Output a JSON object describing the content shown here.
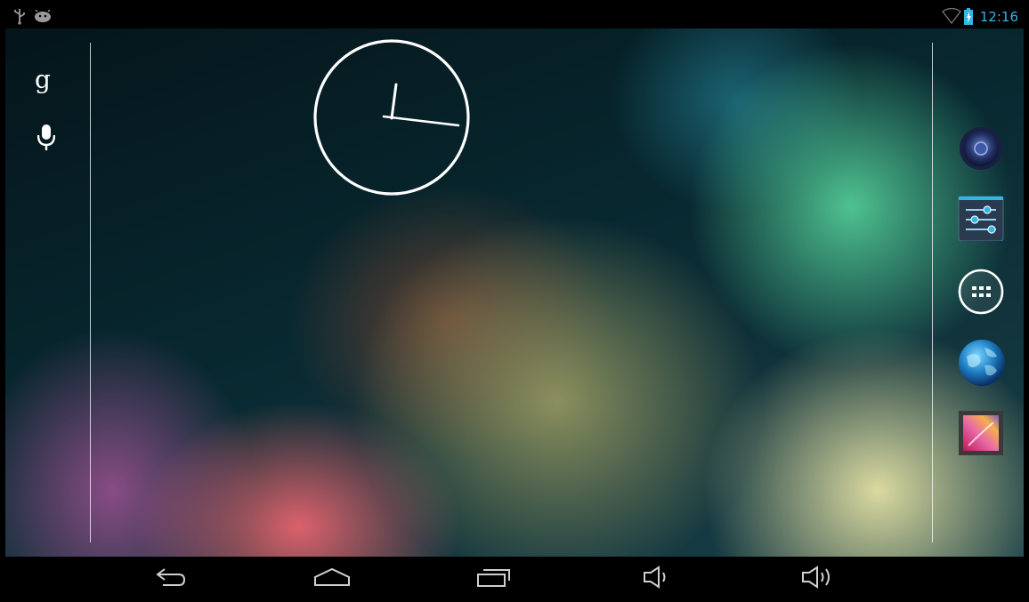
{
  "status_bar": {
    "time": "12:16",
    "left_icons": [
      "usb-icon",
      "android-debug-icon"
    ],
    "right_icons": [
      "wifi-icon",
      "battery-charging-icon"
    ],
    "accent_color": "#33b5e5"
  },
  "search_bar": {
    "google_label": "g",
    "icons": [
      "google-search-icon",
      "voice-search-icon"
    ]
  },
  "clock_widget": {
    "type": "analog",
    "time": "12:16"
  },
  "dock": {
    "items": [
      {
        "name": "music-app",
        "icon": "speaker-icon"
      },
      {
        "name": "settings-app",
        "icon": "sliders-icon"
      },
      {
        "name": "all-apps",
        "icon": "app-drawer-icon"
      },
      {
        "name": "browser-app",
        "icon": "globe-icon"
      },
      {
        "name": "gallery-app",
        "icon": "gallery-icon"
      }
    ]
  },
  "nav_bar": {
    "buttons": [
      "back-icon",
      "home-icon",
      "recents-icon",
      "volume-down-icon",
      "volume-up-icon"
    ]
  }
}
